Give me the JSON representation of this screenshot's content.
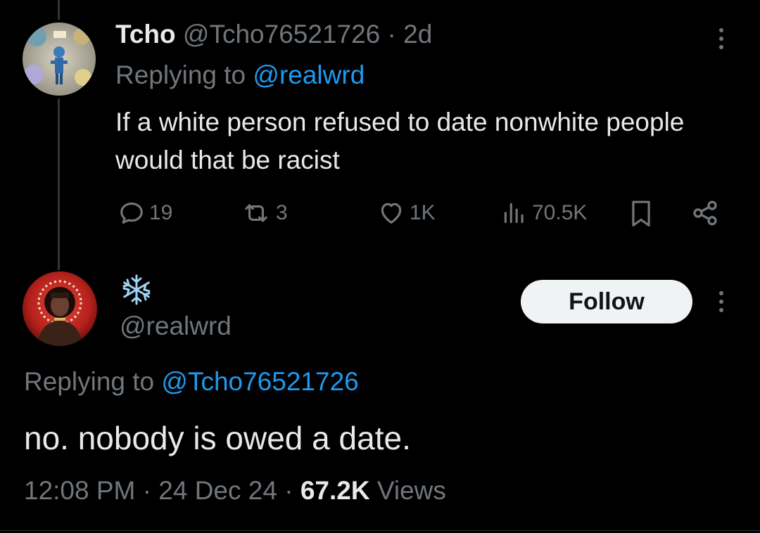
{
  "colors": {
    "background": "#000000",
    "text_primary": "#e7e9ea",
    "text_muted": "#71767b",
    "link": "#1d9bf0",
    "follow_bg": "#eff3f4"
  },
  "tweet1": {
    "author_name": "Tcho",
    "author_handle": "@Tcho76521726",
    "separator": "·",
    "age": "2d",
    "replying_prefix": "Replying to ",
    "replying_handle": "@realwrd",
    "text": "If a white person refused to date nonwhite people would that be racist",
    "avatar_icon": "comic-avatar",
    "more_icon": "more-vertical-icon",
    "actions": {
      "replies": "19",
      "retweets": "3",
      "likes": "1K",
      "views": "70.5K"
    }
  },
  "tweet2": {
    "author_name_emoji": "❄️",
    "author_handle": "@realwrd",
    "follow_label": "Follow",
    "replying_prefix": "Replying to ",
    "replying_handle": "@Tcho76521726",
    "text": "no. nobody is owed a date.",
    "time": "12:08 PM",
    "sep1": "·",
    "date": "24 Dec 24",
    "sep2": "·",
    "views_count": "67.2K",
    "views_label": "Views",
    "avatar_icon": "portrait-avatar",
    "more_icon": "more-vertical-icon"
  }
}
